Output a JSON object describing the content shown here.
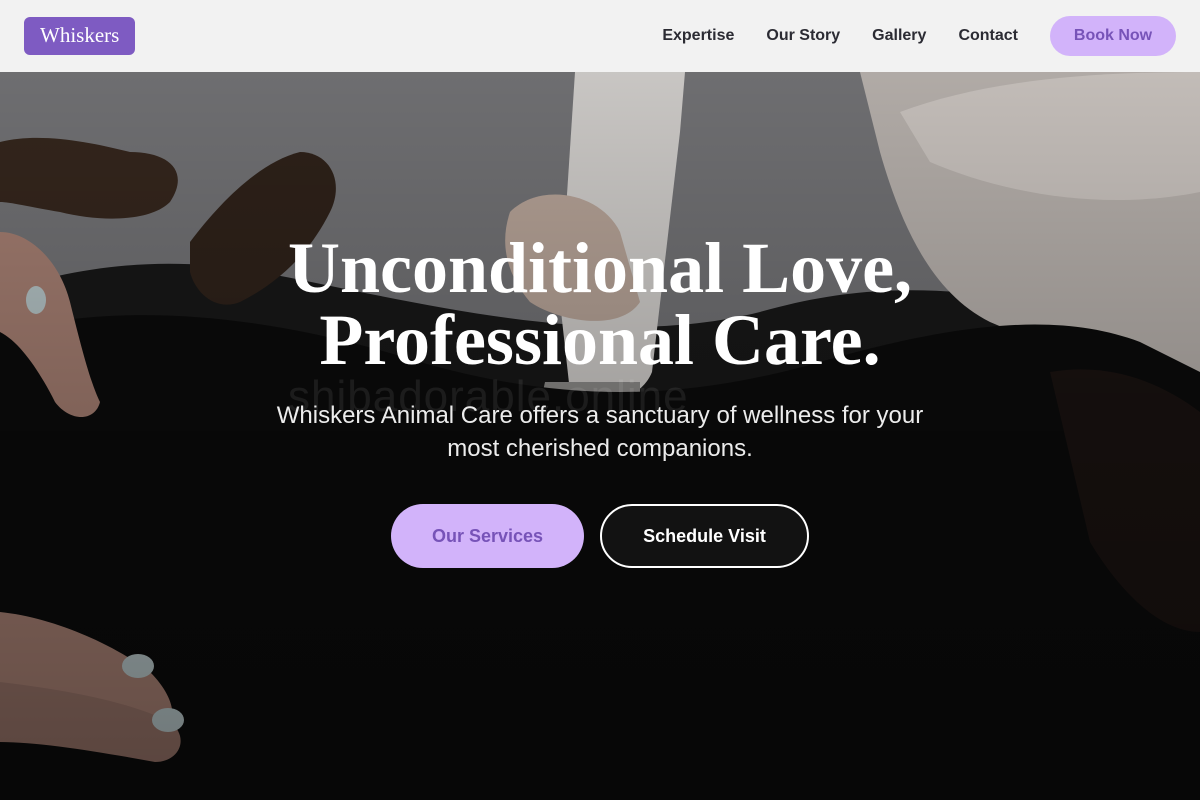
{
  "brand": {
    "logo_text": "Whiskers"
  },
  "nav": {
    "items": [
      {
        "label": "Expertise"
      },
      {
        "label": "Our Story"
      },
      {
        "label": "Gallery"
      },
      {
        "label": "Contact"
      }
    ],
    "book_label": "Book Now"
  },
  "hero": {
    "headline_line1": "Unconditional Love,",
    "headline_line2": "Professional Care.",
    "subtext": "Whiskers Animal Care offers a sanctuary of wellness for your most cherished companions.",
    "watermark": "shibadorable.online",
    "primary_cta": "Our Services",
    "secondary_cta": "Schedule Visit"
  },
  "colors": {
    "brand_purple": "#7e5bc2",
    "accent_lavender": "#d2b3fa",
    "accent_text": "#7753b8",
    "header_bg": "#f2f2f2"
  }
}
